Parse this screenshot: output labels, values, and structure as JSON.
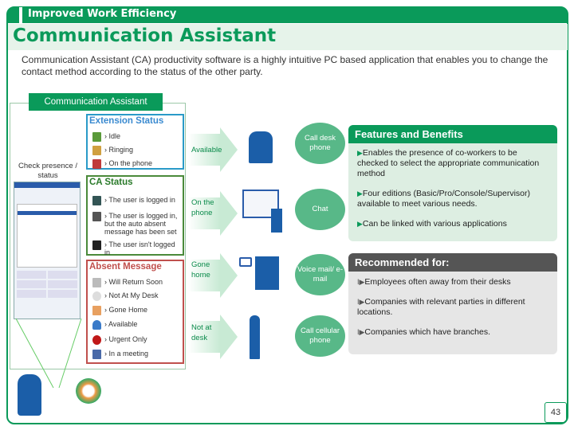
{
  "header": {
    "section": "Improved Work Efficiency",
    "title": "Communication Assistant"
  },
  "description": "Communication Assistant (CA) productivity software is a highly intuitive PC based application that enables you to change the contact method according to the status of the other party.",
  "diagram": {
    "tab_label": "Communication Assistant",
    "check_label": "Check presence / status",
    "extension_status": {
      "title": "Extension Status",
      "color": "#2a9ac8",
      "items": [
        "Idle",
        "Ringing",
        "On the phone"
      ]
    },
    "ca_status": {
      "title": "CA Status",
      "color": "#4a8a3a",
      "items": [
        "The user is logged in",
        "The user is logged in, but the auto absent message has been set",
        "The user isn't logged in"
      ]
    },
    "absent_message": {
      "title": "Absent Message",
      "color": "#c0504d",
      "items": [
        "Will Return Soon",
        "Not At My Desk",
        "Gone Home",
        "Available",
        "Urgent Only",
        "In a meeting"
      ]
    },
    "arrows": [
      "Available",
      "On the phone",
      "Gone home",
      "Not at desk"
    ],
    "actions": [
      "Call desk phone",
      "Chat",
      "Voice mail/ e-mail",
      "Call cellular phone"
    ]
  },
  "features": {
    "title": "Features and Benefits",
    "color": "#0a9a5a",
    "items": [
      "Enables the presence of co-workers to be checked to select the appropriate communication method",
      "Four editions (Basic/Pro/Console/Supervisor) available to meet various needs.",
      "Can be linked with various applications"
    ]
  },
  "recommended": {
    "title": "Recommended for:",
    "color": "#555555",
    "items": [
      "Employees often away from their desks",
      "Companies with relevant parties in different locations.",
      "Companies which have branches."
    ]
  },
  "page_number": "43"
}
